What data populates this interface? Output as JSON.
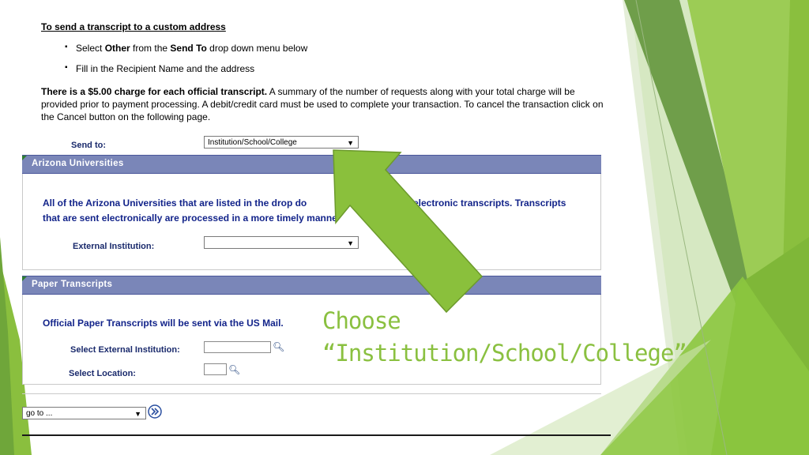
{
  "instructions": {
    "heading": "To send a transcript to a custom address",
    "bullets": [
      {
        "pre": "Select ",
        "b1": "Other",
        "mid": " from the ",
        "b2": "Send To",
        "post": " drop down menu below"
      },
      {
        "pre": "Fill in the Recipient Name and the address"
      }
    ],
    "charge_bold": "There is a $5.00 charge for each official transcript.",
    "charge_rest": "  A summary of the number of requests along with your total charge will be provided prior to payment processing.  A debit/credit card must be used to complete your transaction. To cancel the transaction click on the Cancel button on the following page."
  },
  "send_to": {
    "label": "Send to:",
    "value": "Institution/School/College"
  },
  "arizona": {
    "title": "Arizona Universities",
    "text1": "All of the Arizona Universities that are listed in the drop do",
    "text1_end": "electronic transcripts. Transcripts",
    "text2": "that are sent electronically are processed in a more timely manne",
    "ext_label": "External Institution:",
    "ext_value": ""
  },
  "paper": {
    "title": "Paper Transcripts",
    "text": "Official Paper Transcripts will be sent via the US Mail.",
    "select_ext_label": "Select External Institution:",
    "select_loc_label": "Select Location:"
  },
  "footer": {
    "goto_value": "go to ..."
  },
  "callout": {
    "line1": "Choose",
    "line2": "“Institution/School/College”"
  },
  "colors": {
    "arrow_green": "#8ac03c",
    "band_blue": "#7a86b8",
    "label_navy": "#1a2a6c"
  },
  "icons": {
    "dropdown": "triangle-down",
    "lookup": "magnifier",
    "go": "double-chevron-right"
  }
}
